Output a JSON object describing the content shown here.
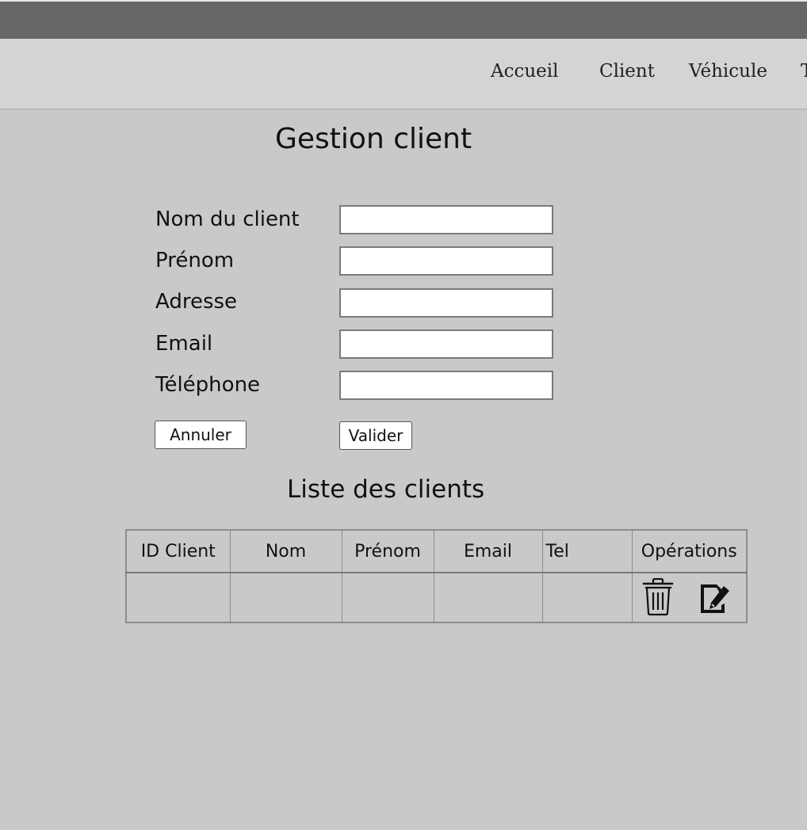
{
  "nav": {
    "items": [
      {
        "label": "Accueil"
      },
      {
        "label": "Client"
      },
      {
        "label": "Véhicule"
      },
      {
        "label": "T"
      }
    ]
  },
  "form": {
    "title": "Gestion client",
    "fields": [
      {
        "label": "Nom du client",
        "value": ""
      },
      {
        "label": "Prénom",
        "value": ""
      },
      {
        "label": "Adresse",
        "value": ""
      },
      {
        "label": "Email",
        "value": ""
      },
      {
        "label": "Téléphone",
        "value": ""
      }
    ],
    "cancel_label": "Annuler",
    "submit_label": "Valider"
  },
  "list": {
    "title": "Liste des clients",
    "columns": [
      "ID Client",
      "Nom",
      "Prénom",
      "Email",
      "Tel",
      "Opérations"
    ],
    "rows": [
      {
        "cells": [
          "",
          "",
          "",
          "",
          ""
        ],
        "operations": [
          "trash-icon",
          "edit-icon"
        ]
      }
    ]
  },
  "colors": {
    "title_bar": "#676767",
    "nav_bar": "#d4d4d4",
    "page_background": "#c9c9c9"
  }
}
